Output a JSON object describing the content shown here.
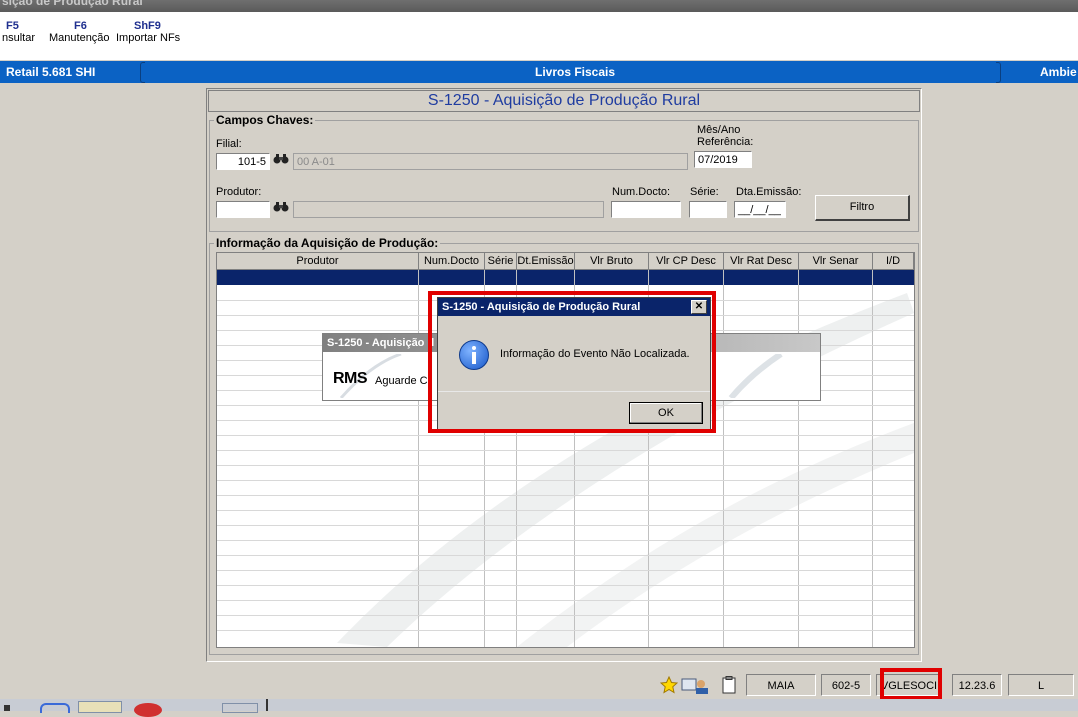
{
  "window": {
    "title": "sição de Produção Rural"
  },
  "toolbar": {
    "keys": [
      {
        "key": "F5",
        "label": "nsultar"
      },
      {
        "key": "F6",
        "label": "Manutenção"
      },
      {
        "key": "ShF9",
        "label": "Importar NFs"
      }
    ]
  },
  "banner": {
    "left": "Retail 5.681 SHI",
    "center": "Livros Fiscais",
    "right": "Ambie"
  },
  "form": {
    "title": "S-1250 - Aquisição de Produção Rural",
    "campos_chaves": {
      "group_label": "Campos Chaves:",
      "filial_label": "Filial:",
      "filial_value": "101-5",
      "filial_desc": "00 A-01",
      "mes_ano_label_1": "Mês/Ano",
      "mes_ano_label_2": "Referência:",
      "mes_ano_value": "07/2019",
      "produtor_label": "Produtor:",
      "produtor_value": "",
      "num_docto_label": "Num.Docto:",
      "serie_label": "Série:",
      "dta_emissao_label": "Dta.Emissão:",
      "dta_emissao_value": "__/__/__",
      "filtro_label": "Filtro"
    },
    "info_group_label": "Informação da Aquisição de Produção:",
    "grid_columns": [
      "Produtor",
      "Num.Docto",
      "Série",
      "Dt.Emissão",
      "Vlr Bruto",
      "Vlr CP Desc",
      "Vlr Rat Desc",
      "Vlr Senar",
      "I/D"
    ]
  },
  "wait_dialog": {
    "title": "S-1250 - Aquisição d",
    "logo": "RMS",
    "text": "Aguarde C"
  },
  "message_dialog": {
    "title": "S-1250 - Aquisição de Produção Rural",
    "close": "✕",
    "message": "Informação do Evento Não Localizada.",
    "ok_label": "OK"
  },
  "statusbar": {
    "user": "MAIA",
    "code": "602-5",
    "db": "VGLESOCI",
    "version": "12.23.6",
    "flag": "L"
  },
  "colors": {
    "banner": "#0b62c4",
    "dialog_title": "#0a246a",
    "highlight": "#e00000",
    "selected_row": "#0a246a"
  }
}
